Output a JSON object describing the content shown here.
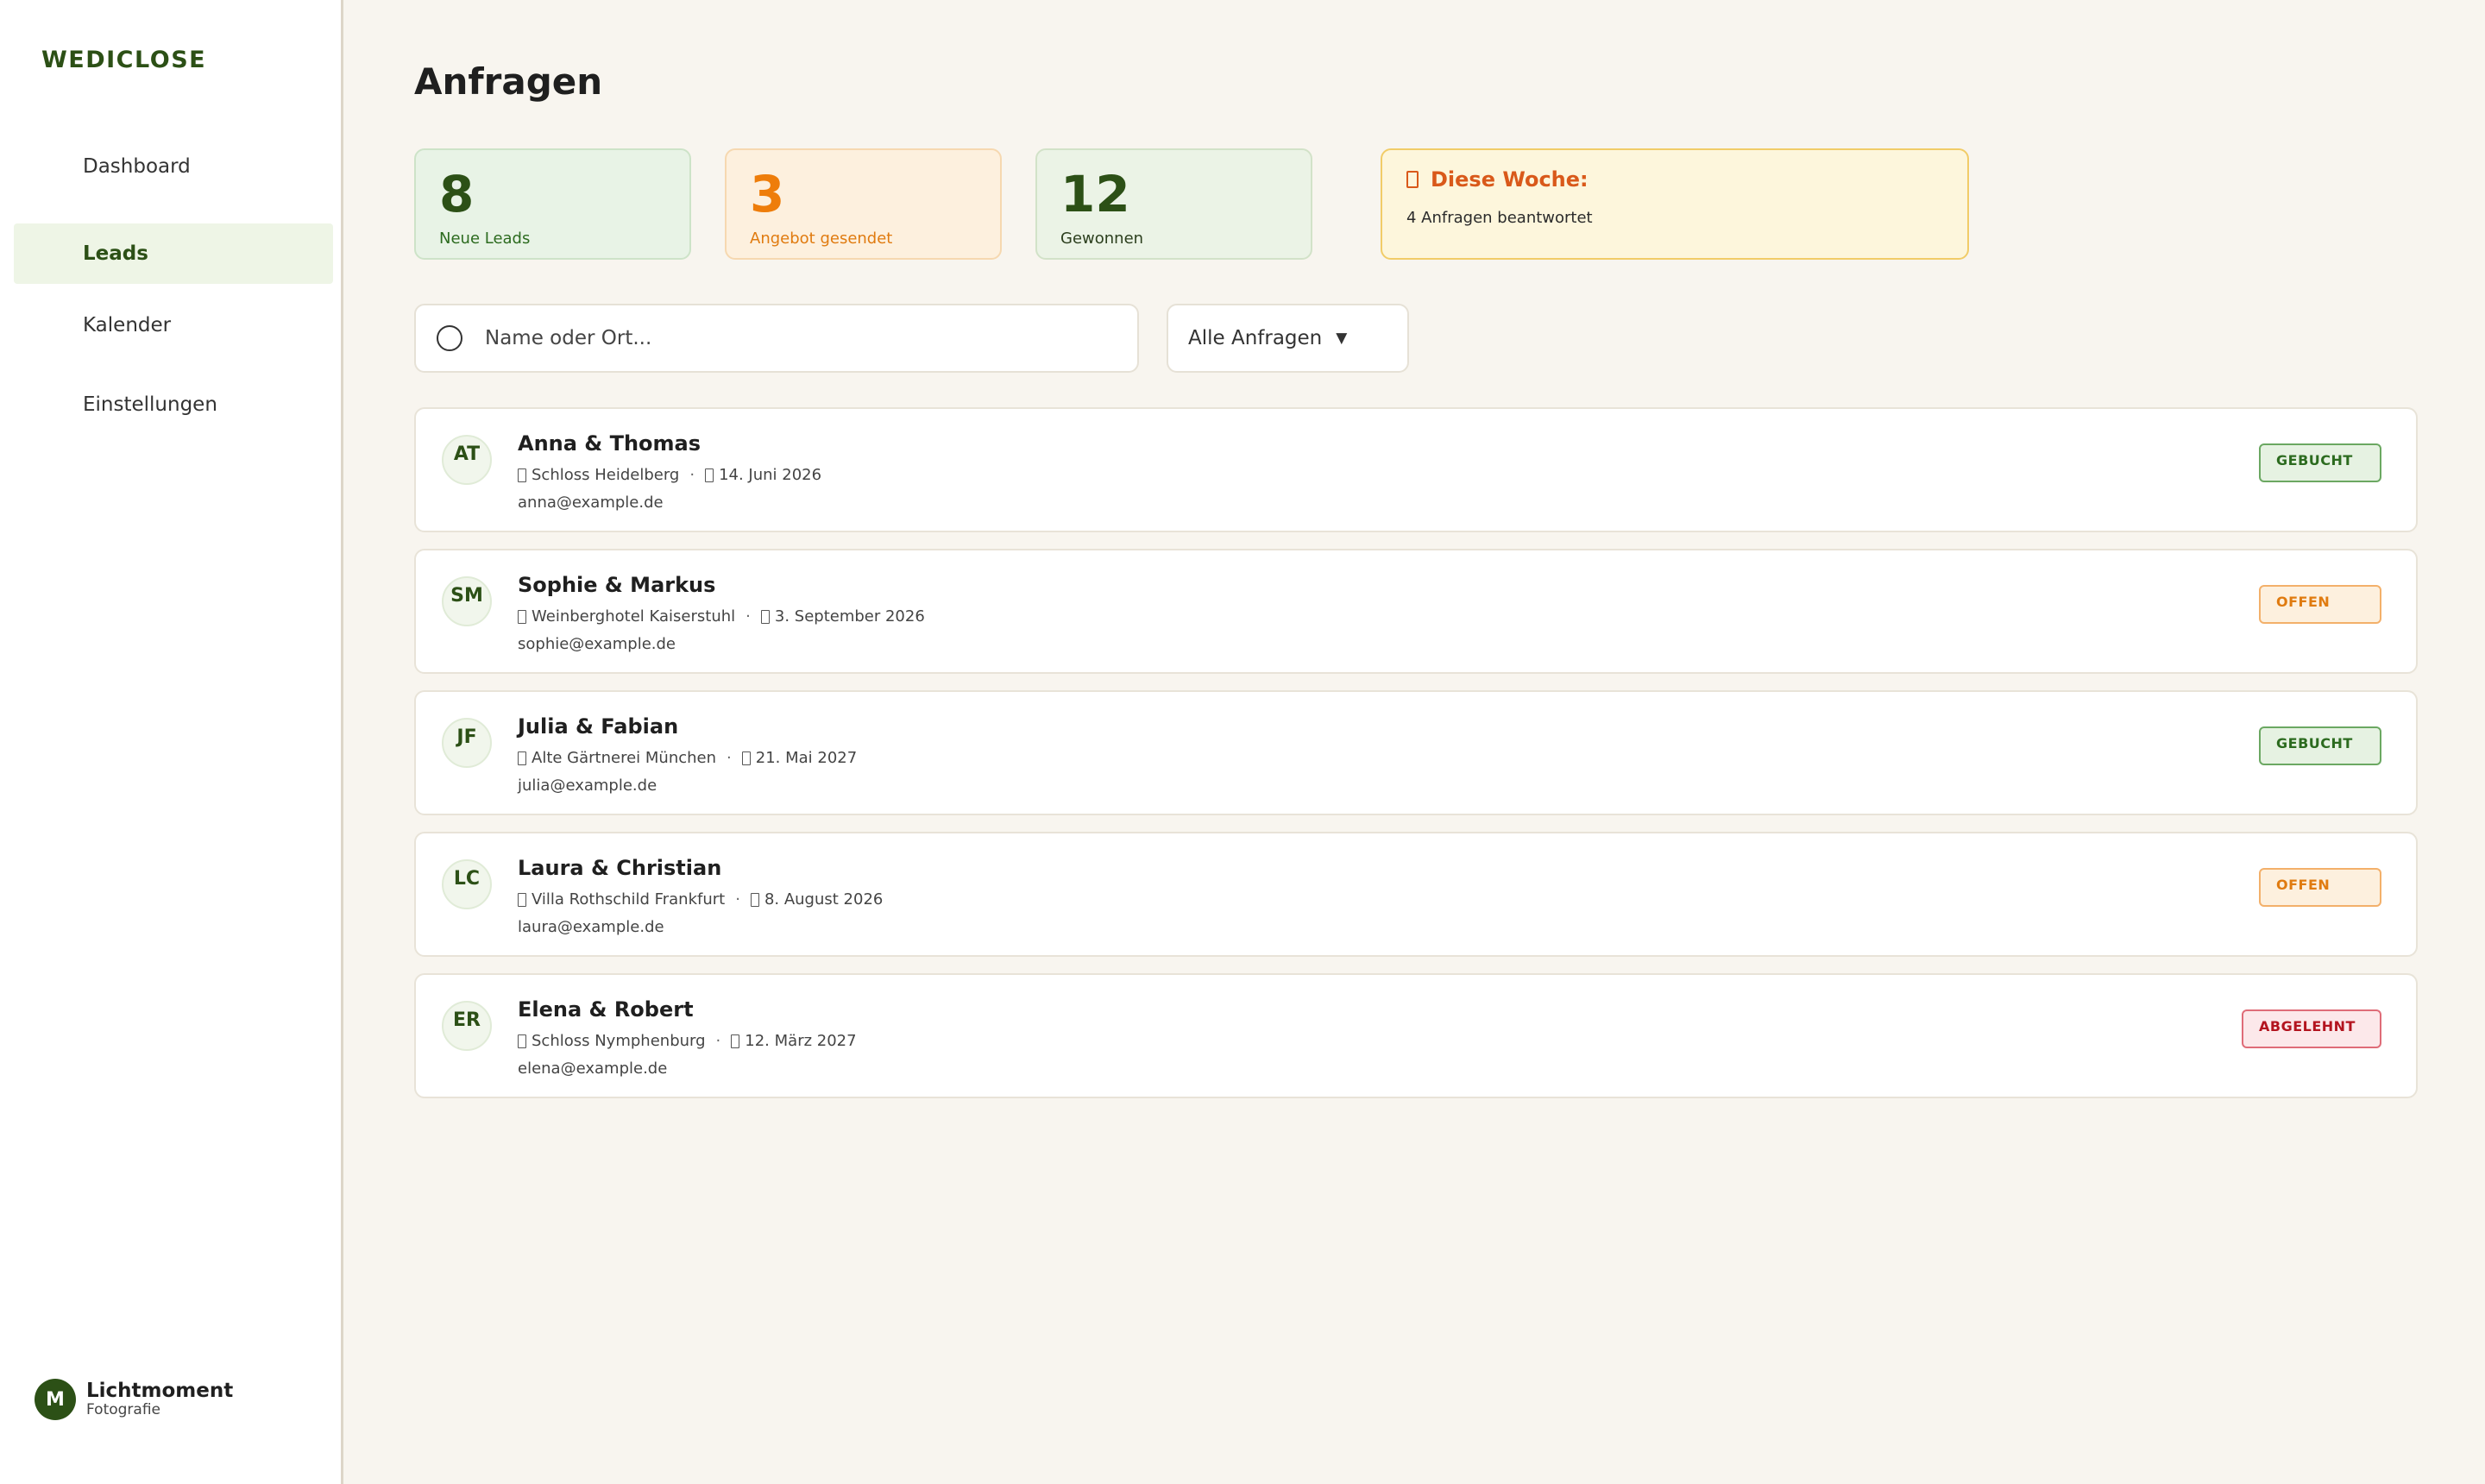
{
  "sidebar": {
    "brand": "WEDICLOSE",
    "items": [
      {
        "label": "Dashboard",
        "active": false
      },
      {
        "label": "Leads",
        "active": true
      },
      {
        "label": "Kalender",
        "active": false
      },
      {
        "label": "Einstellungen",
        "active": false
      }
    ],
    "profile": {
      "initial": "M",
      "name": "Lichtmoment",
      "subtitle": "Fotografie"
    }
  },
  "main": {
    "title": "Anfragen",
    "stats": [
      {
        "value": "8",
        "label": "Neue Leads"
      },
      {
        "value": "3",
        "label": "Angebot gesendet"
      },
      {
        "value": "12",
        "label": "Gewonnen"
      }
    ],
    "week": {
      "title": "Diese Woche:",
      "text": "4 Anfragen beantwortet"
    },
    "search": {
      "placeholder": "Name oder Ort..."
    },
    "filter": {
      "selected": "Alle Anfragen",
      "chevron": "▼"
    },
    "leads": [
      {
        "initials": "AT",
        "name": "Anna & Thomas",
        "venue": "Schloss Heidelberg",
        "date": "14. Juni 2026",
        "email": "anna@example.de",
        "status": "GEBUCHT"
      },
      {
        "initials": "SM",
        "name": "Sophie & Markus",
        "venue": "Weinberghotel Kaiserstuhl",
        "date": "3. September 2026",
        "email": "sophie@example.de",
        "status": "OFFEN"
      },
      {
        "initials": "JF",
        "name": "Julia & Fabian",
        "venue": "Alte Gärtnerei München",
        "date": "21. Mai 2027",
        "email": "julia@example.de",
        "status": "GEBUCHT"
      },
      {
        "initials": "LC",
        "name": "Laura & Christian",
        "venue": "Villa Rothschild Frankfurt",
        "date": "8. August 2026",
        "email": "laura@example.de",
        "status": "OFFEN"
      },
      {
        "initials": "ER",
        "name": "Elena & Robert",
        "venue": "Schloss Nymphenburg",
        "date": "12. März 2027",
        "email": "elena@example.de",
        "status": "ABGELEHNT"
      }
    ]
  },
  "colors": {
    "brand": "#2c5016",
    "accent_orange": "#ee7d0a",
    "background": "#f8f5ef",
    "status_booked": "#2c6b1f",
    "status_open": "#e07b10",
    "status_declined": "#b3141f"
  }
}
